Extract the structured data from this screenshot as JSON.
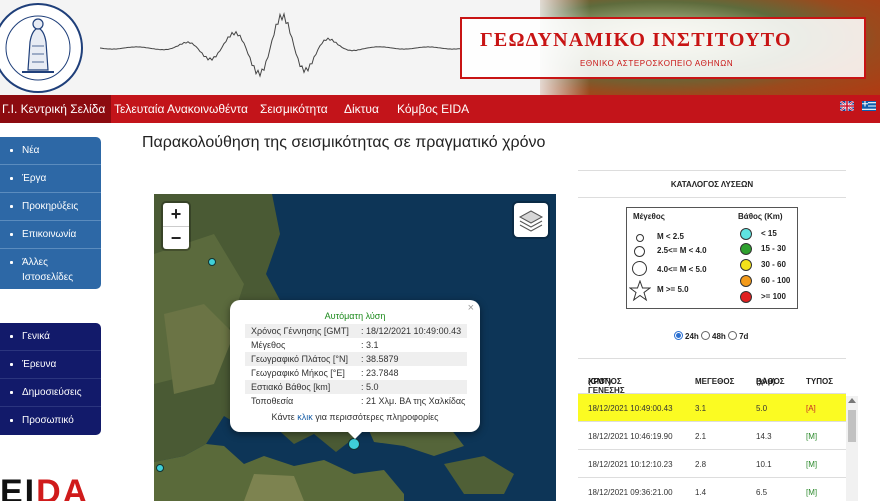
{
  "header": {
    "institute_title": "ΓΕΩΔΥΝΑΜΙΚΟ ΙΝΣΤΙΤΟΥΤΟ",
    "institute_subtitle": "ΕΘΝΙΚΟ ΑΣΤΕΡΟΣΚΟΠΕΙΟ ΑΘΗΝΩΝ",
    "logo_text": "ΕΘΝΙΚΟΝ ΑΣΤΕΡΟΣΚΟΠΕΙΟΝ ΑΘΗΝΩΝ · NATIONAL OBSERVATORY ATHENS"
  },
  "nav": {
    "items": [
      {
        "label": "Γ.Ι. Κεντρική Σελίδα",
        "active": true
      },
      {
        "label": "Τελευταία Ανακοινωθέντα",
        "active": false
      },
      {
        "label": "Σεισμικότητα",
        "active": false
      },
      {
        "label": "Δίκτυα",
        "active": false
      },
      {
        "label": "Κόμβος EIDA",
        "active": false
      }
    ]
  },
  "sidebar": {
    "top_items": [
      {
        "label": "Νέα"
      },
      {
        "label": "Έργα"
      },
      {
        "label": "Προκηρύξεις"
      },
      {
        "label": "Επικοινωνία"
      },
      {
        "label": "Άλλες Ιστοσελίδες"
      }
    ],
    "bottom_items": [
      {
        "label": "Γενικά"
      },
      {
        "label": "Έρευνα"
      },
      {
        "label": "Δημοσιεύσεις"
      },
      {
        "label": "Προσωπικό"
      }
    ]
  },
  "eida_logo": {
    "part1": "EI",
    "part2": "DA"
  },
  "page_title": "Παρακολούθηση της σεισμικότητας σε πραγματικό χρόνο",
  "map": {
    "zoom_in": "+",
    "zoom_out": "−",
    "popup": {
      "heading": "Αυτόματη λύση",
      "close": "×",
      "rows": [
        {
          "label": "Χρόνος Γέννησης [GMT]",
          "value": ": 18/12/2021 10:49:00.43"
        },
        {
          "label": "Μέγεθος",
          "value": ": 3.1"
        },
        {
          "label": "Γεωγραφικό Πλάτος [°N]",
          "value": ": 38.5879"
        },
        {
          "label": "Γεωγραφικό Μήκος [°E]",
          "value": ": 23.7848"
        },
        {
          "label": "Εστιακό Βάθος [km]",
          "value": ": 5.0"
        },
        {
          "label": "Τοποθεσία",
          "value": ": 21 Χλμ. ΒΑ της Χαλκίδας"
        }
      ],
      "link_prefix": "Κάντε ",
      "link_text": "κλικ",
      "link_suffix": " για περισσότερες πληροφορίες"
    }
  },
  "catalog": {
    "title": "ΚΑΤΑΛΟΓΟΣ ΛΥΣΕΩΝ",
    "legend": {
      "magnitude_title": "Μέγεθος",
      "depth_title": "Βάθος (Km)",
      "magnitudes": [
        "M < 2.5",
        "2.5<= M < 4.0",
        "4.0<= M < 5.0",
        "M >= 5.0"
      ],
      "depths": [
        {
          "label": "< 15",
          "color": "#5fe3e0"
        },
        {
          "label": "15 - 30",
          "color": "#2ea02e"
        },
        {
          "label": "30 - 60",
          "color": "#f3e21a"
        },
        {
          "label": "60 - 100",
          "color": "#f39a1a"
        },
        {
          "label": ">= 100",
          "color": "#e02020"
        }
      ]
    },
    "periods": [
      {
        "label": "24h",
        "selected": true
      },
      {
        "label": "48h",
        "selected": false
      },
      {
        "label": "7d",
        "selected": false
      }
    ],
    "table": {
      "col_time": [
        "ΧΡΟΝΟΣ ΓΕΝΕΣΗΣ",
        "(GMT)"
      ],
      "col_mag": "ΜΕΓΕΘΟΣ",
      "col_depth": [
        "ΒΑΘΟΣ",
        "(χλμ)"
      ],
      "col_type": "ΤΥΠΟΣ",
      "rows": [
        {
          "time": "18/12/2021 10:49:00.43",
          "mag": "3.1",
          "depth": "5.0",
          "type": "[A]",
          "highlight": true
        },
        {
          "time": "18/12/2021 10:46:19.90",
          "mag": "2.1",
          "depth": "14.3",
          "type": "[M]",
          "highlight": false
        },
        {
          "time": "18/12/2021 10:12:10.23",
          "mag": "2.8",
          "depth": "10.1",
          "type": "[M]",
          "highlight": false
        },
        {
          "time": "18/12/2021 09:36:21.00",
          "mag": "1.4",
          "depth": "6.5",
          "type": "[M]",
          "highlight": false
        }
      ]
    }
  }
}
